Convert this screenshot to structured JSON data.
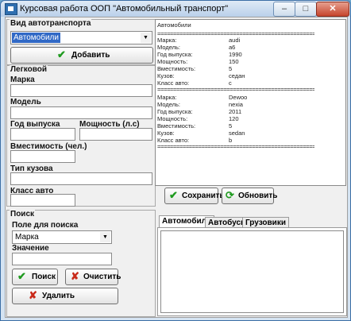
{
  "window": {
    "title": "Курсовая работа ООП \"Автомобильный транспорт\"",
    "minimize": "–",
    "maximize": "□",
    "close": "✕"
  },
  "vehicle_group": {
    "label": "Вид автотранспорта",
    "type_value": "Автомобили",
    "add_button": "Добавить"
  },
  "car_group": {
    "label": "Легковой",
    "brand_label": "Марка",
    "model_label": "Модель",
    "year_label": "Год выпуска",
    "power_label": "Мощность (л.с)",
    "capacity_label": "Вместимость (чел.)",
    "body_label": "Тип кузова",
    "class_label": "Класс авто"
  },
  "output": {
    "header": "Автомобили",
    "separator": "==========================================================================",
    "records": [
      {
        "rows": [
          {
            "key": "Марка:",
            "value": "audi"
          },
          {
            "key": "Модель:",
            "value": "a6"
          },
          {
            "key": "Год выпуска:",
            "value": "1990"
          },
          {
            "key": "Мощность:",
            "value": "150"
          },
          {
            "key": "Вместимость:",
            "value": "5"
          },
          {
            "key": "Кузов:",
            "value": "седан"
          },
          {
            "key": "Класс авто:",
            "value": "c"
          }
        ]
      },
      {
        "rows": [
          {
            "key": "Марка:",
            "value": "Dewoo"
          },
          {
            "key": "Модель:",
            "value": "nexia"
          },
          {
            "key": "Год выпуска:",
            "value": "2011"
          },
          {
            "key": "Мощность:",
            "value": "120"
          },
          {
            "key": "Вместимость:",
            "value": "5"
          },
          {
            "key": "Кузов:",
            "value": "sedan"
          },
          {
            "key": "Класс авто:",
            "value": "b"
          }
        ]
      }
    ],
    "save_button": "Сохранить",
    "refresh_button": "Обновить"
  },
  "search_group": {
    "label": "Поиск",
    "field_label": "Поле для поиска",
    "field_value": "Марка",
    "value_label": "Значение",
    "search_button": "Поиск",
    "clear_button": "Очистить",
    "delete_button": "Удалить"
  },
  "tabs": [
    {
      "label": "Автомобили",
      "active": true
    },
    {
      "label": "Автобусы",
      "active": false
    },
    {
      "label": "Грузовики",
      "active": false
    }
  ],
  "icons": {
    "check": "green-check-icon",
    "cross": "red-x-icon",
    "refresh": "refresh-icon",
    "dropdown": "chevron-down-icon"
  }
}
